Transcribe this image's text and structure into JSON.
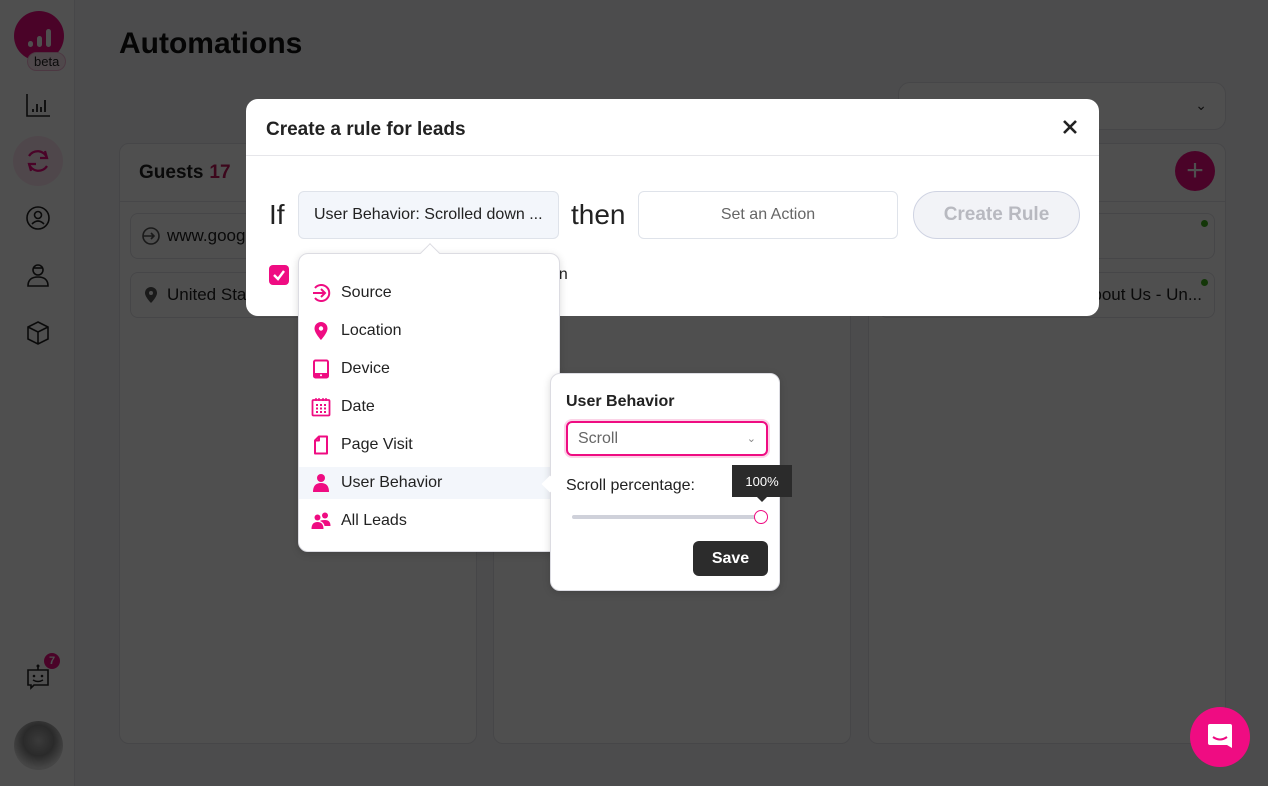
{
  "sidebar": {
    "logo_badge": "beta",
    "items": [
      {
        "name": "analytics",
        "icon": "bar-chart-icon",
        "active": false
      },
      {
        "name": "automations",
        "icon": "sync-icon",
        "active": true
      },
      {
        "name": "contacts",
        "icon": "user-circle-icon",
        "active": false
      },
      {
        "name": "visitors",
        "icon": "user-cap-icon",
        "active": false
      },
      {
        "name": "integrations",
        "icon": "cube-icon",
        "active": false
      }
    ],
    "bot_badge_count": "7",
    "bot_icon": "chatbot-icon",
    "avatar_icon": "user-avatar"
  },
  "page": {
    "title": "Automations",
    "columns": [
      {
        "title": "Guests",
        "count": "17",
        "cards": [
          {
            "icon": "source-icon",
            "text": "www.google"
          },
          {
            "icon": "location-icon",
            "text": "United State"
          }
        ]
      },
      {
        "title": "",
        "count": "",
        "cards": []
      },
      {
        "title": "",
        "count": "",
        "cards": [
          {
            "icon": "",
            "text": ""
          },
          {
            "icon": "",
            "text": "About Us - Un..."
          }
        ]
      }
    ],
    "add_button_icon": "plus-icon"
  },
  "modal": {
    "title": "Create a rule for leads",
    "if_label": "If",
    "condition_value": "User Behavior: Scrolled down ...",
    "then_label": "then",
    "action_placeholder": "Set an Action",
    "create_button": "Create Rule",
    "checkbox_checked": true,
    "checkbox_label_visible": "on"
  },
  "category_menu": {
    "items": [
      {
        "label": "Source",
        "icon": "source-icon",
        "selected": false
      },
      {
        "label": "Location",
        "icon": "location-pin-icon",
        "selected": false
      },
      {
        "label": "Device",
        "icon": "tablet-icon",
        "selected": false
      },
      {
        "label": "Date",
        "icon": "calendar-icon",
        "selected": false
      },
      {
        "label": "Page Visit",
        "icon": "page-icon",
        "selected": false
      },
      {
        "label": "User Behavior",
        "icon": "user-icon",
        "selected": true
      },
      {
        "label": "All Leads",
        "icon": "users-icon",
        "selected": false
      }
    ]
  },
  "behavior_panel": {
    "title": "User Behavior",
    "select_value": "Scroll",
    "scroll_label": "Scroll percentage:",
    "scroll_percent": 100,
    "tooltip": "100%",
    "save_button": "Save"
  },
  "colors": {
    "accent": "#ef0c82",
    "dark_button": "#2c2c2c",
    "selected_bg": "#f3f6fb"
  }
}
